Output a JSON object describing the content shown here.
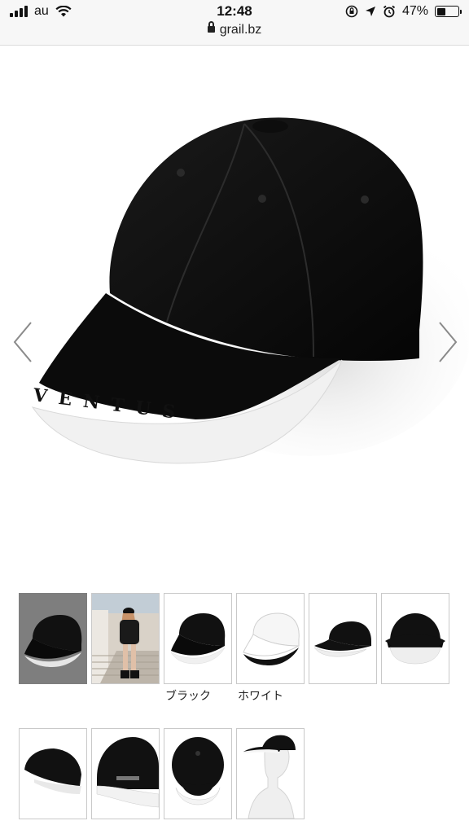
{
  "status_bar": {
    "carrier": "au",
    "time": "12:48",
    "battery_percent": "47%",
    "battery_level": 0.47,
    "url": "grail.bz"
  },
  "gallery": {
    "main_image": {
      "alt": "black cap",
      "brim_text": "VENTUS"
    },
    "prev_icon": "chevron-left-icon",
    "next_icon": "chevron-right-icon",
    "color_labels": {
      "black": "ブラック",
      "white": "ホワイト"
    },
    "thumbnails_row1": [
      "black-cap-side",
      "model-photo",
      "black-cap",
      "white-cap",
      "black-cap-profile",
      "black-cap-front"
    ],
    "thumbnails_row2": [
      "black-cap-back-left",
      "black-cap-back",
      "black-cap-top",
      "cap-on-mannequin"
    ]
  }
}
